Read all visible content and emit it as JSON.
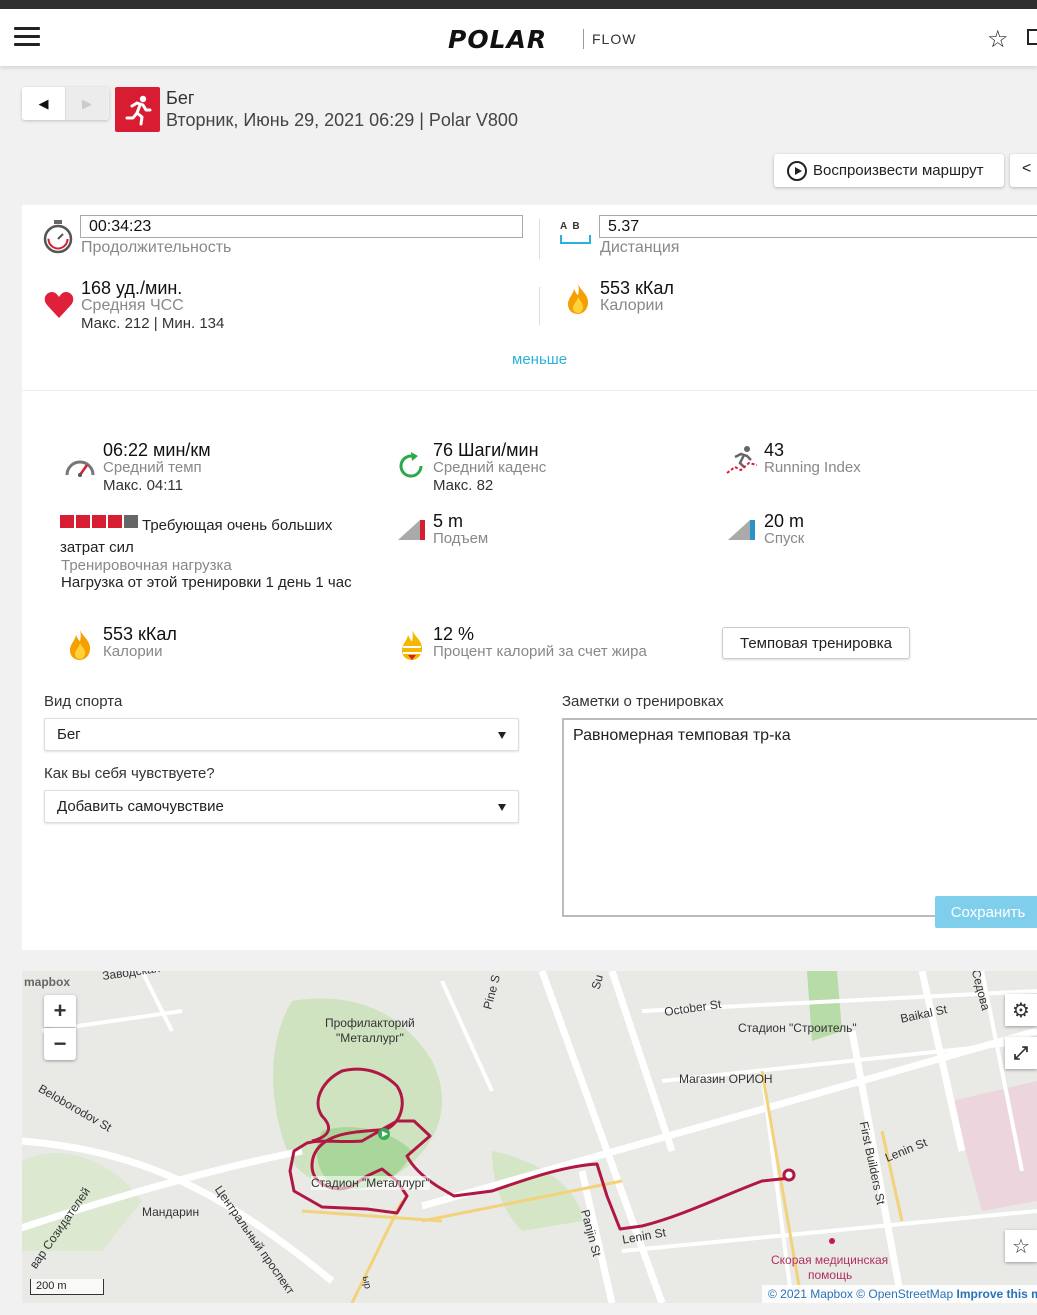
{
  "header": {
    "brand": "POLAR",
    "product": "FLOW"
  },
  "exercise": {
    "sport_name": "Бег",
    "subtitle": "Вторник, Июнь 29, 2021 06:29 | Polar V800",
    "replay_label": "Воспроизвести маршрут"
  },
  "summary": {
    "duration_value": "00:34:23",
    "duration_label": "Продолжительность",
    "distance_value": "5.37",
    "distance_label": "Дистанция",
    "distance_icon_text": "A  B",
    "hr_value": "168 уд./мин.",
    "hr_label": "Средняя ЧСС",
    "hr_minmax": "Макс. 212  |  Мин. 134",
    "calories_value": "553 кКал",
    "calories_label": "Калории",
    "less_link": "меньше"
  },
  "details": {
    "pace_value": "06:22 мин/км",
    "pace_label": "Средний темп",
    "pace_max": "Макс. 04:11",
    "cadence_value": "76 Шаги/мин",
    "cadence_label": "Средний каденс",
    "cadence_max": "Макс. 82",
    "running_index_value": "43",
    "running_index_label": "Running Index",
    "load_title": "Требующая очень больших затрат сил",
    "load_label": "Тренировочная нагрузка",
    "load_recovery": "Нагрузка от этой тренировки 1 день 1 час",
    "ascent_value": "5 m",
    "ascent_label": "Подъем",
    "descent_value": "20 m",
    "descent_label": "Спуск",
    "calories_value": "553 кКал",
    "calories_label": "Калории",
    "fat_value": "12 %",
    "fat_label": "Процент калорий за счет жира",
    "tempo_button": "Темповая тренировка"
  },
  "form": {
    "sport_label": "Вид спорта",
    "sport_value": "Бег",
    "feeling_label": "Как вы себя чувствуете?",
    "feeling_value": "Добавить самочувствие",
    "notes_label": "Заметки о тренировках",
    "notes_value": "Равномерная темповая тр-ка",
    "save_label": "Сохранить"
  },
  "map": {
    "zoom_in": "+",
    "zoom_out": "−",
    "scale": "200 m",
    "mapbox": "mapbox",
    "attribution_mapbox": "© 2021 Mapbox",
    "attribution_osm": "© OpenStreetMap",
    "attribution_improve": "Improve this m",
    "labels": {
      "zavodskaya": "Заводская",
      "pine": "Pine S",
      "sun": "Su",
      "october": "October St",
      "sedova": "Седова",
      "baikal": "Baikal St",
      "stroitel": "Стадион \"Строитель\"",
      "profilaktory1": "Профилакторий",
      "profilaktory2": "\"Металлург\"",
      "orion": "Магазин ОРИОН",
      "beloborodov": "Beloborodov St",
      "lenin1": "Lenin St",
      "lenin2": "Lenin St",
      "first_builders": "First Builders St",
      "stadium": "Стадион \"Металлург\"",
      "mandarin": "Мандарин",
      "central": "Центральный проспект",
      "panjin": "Panjin St",
      "sozidateley": "вар Созидателей",
      "ambulance1": "Скорая медицинская",
      "ambulance2": "помощь",
      "vertical": "ыр"
    }
  },
  "colors": {
    "accent": "#d81d32",
    "route": "#c2185b",
    "link": "#2ab3d8",
    "save": "#7fcfec"
  }
}
